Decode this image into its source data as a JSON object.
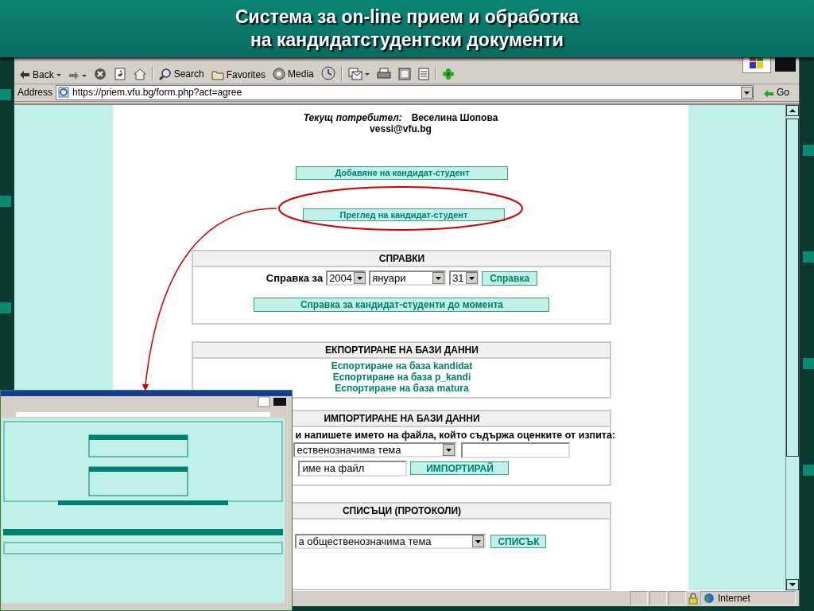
{
  "slide_title": [
    "Система за on-line прием и обработка",
    "на кандидатстудентски документи"
  ],
  "toolbar": [
    {
      "kind": "back",
      "label": "Back"
    },
    {
      "kind": "forward"
    },
    {
      "kind": "stop"
    },
    {
      "kind": "refresh"
    },
    {
      "kind": "home"
    },
    {
      "kind": "search",
      "label": "Search"
    },
    {
      "kind": "favorites",
      "label": "Favorites"
    },
    {
      "kind": "media",
      "label": "Media"
    },
    {
      "kind": "history"
    },
    {
      "kind": "mail"
    },
    {
      "kind": "print"
    },
    {
      "kind": "edit"
    },
    {
      "kind": "discuss"
    },
    {
      "kind": "messenger"
    }
  ],
  "address": {
    "label": "Address",
    "url": "https://priem.vfu.bg/form.php?act=agree",
    "go": "Go"
  },
  "user": {
    "label": "Текущ потребител:",
    "name": "Веселина Шопова",
    "email": "vessi@vfu.bg"
  },
  "actions": [
    {
      "label": "Добавяне на кандидат-студент"
    },
    {
      "label": "Преглед на кандидат-студент"
    }
  ],
  "reports": {
    "title": "СПРАВКИ",
    "label": "Справка за",
    "year": "2004",
    "month": "януари",
    "day": "31",
    "button": "Справка",
    "summary_button": "Справка за кандидат-студенти до момента"
  },
  "export": {
    "title": "ЕКПОРТИРАНЕ НА БАЗИ ДАННИ",
    "links": [
      "Еспортиране на база kandidat",
      "Еспортиране на база p_kandi",
      "Еспортиране на база matura"
    ]
  },
  "import": {
    "title": "ИМПОРТИРАНЕ НА БАЗИ ДАННИ",
    "instruction": "и напишете името на файла, който съдържа оценките от изпита:",
    "select": "ественозначима тема",
    "file_field": "име на файл",
    "button": "ИМПОРТИРАЙ"
  },
  "lists": {
    "title": "СПИСЪЦИ (ПРОТОКОЛИ)",
    "select": "а общественозначима тема",
    "button": "СПИСЪК"
  },
  "status_bar": {
    "zone": "Internet"
  }
}
